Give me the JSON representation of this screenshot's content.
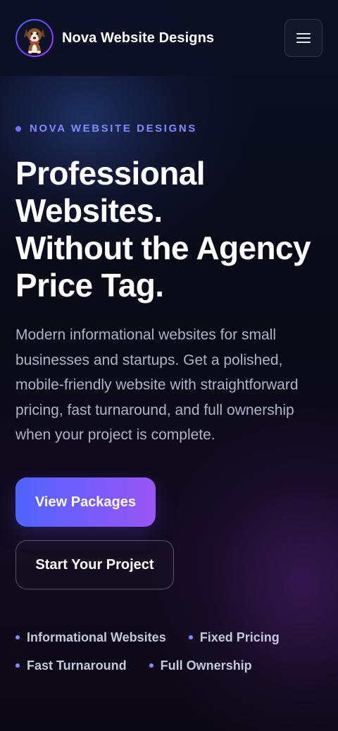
{
  "header": {
    "brand_name": "Nova Website Designs",
    "logo_icon": "dog-mascot-icon",
    "menu_icon": "hamburger-menu-icon"
  },
  "hero": {
    "eyebrow": "NOVA WEBSITE DESIGNS",
    "headline_lines": [
      "Professional",
      "Websites.",
      "Without the Agency",
      "Price Tag."
    ],
    "lead": "Modern informational websites for small businesses and startups. Get a polished, mobile-friendly website with straightforward pricing, fast turnaround, and full ownership when your project is complete.",
    "primary_cta": "View Packages",
    "secondary_cta": "Start Your Project",
    "features": [
      "Informational Websites",
      "Fixed Pricing",
      "Fast Turnaround",
      "Full Ownership"
    ]
  },
  "colors": {
    "accent": "#7e8cff",
    "gradient_start": "#4f64ff",
    "gradient_end": "#9b55f6"
  }
}
